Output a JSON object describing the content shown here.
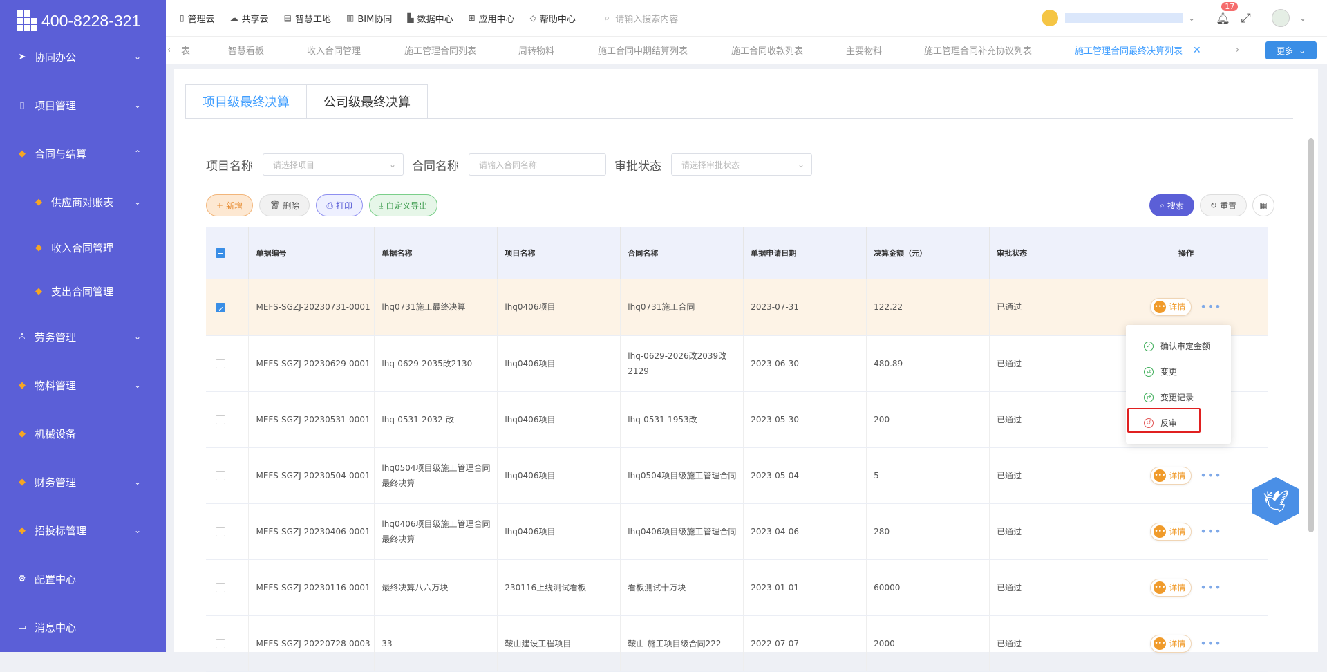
{
  "logo": {
    "phone": "400-8228-321"
  },
  "sidebar": {
    "items": [
      {
        "label": "协同办公",
        "icon": "send-icon"
      },
      {
        "label": "项目管理",
        "icon": "book-icon"
      },
      {
        "label": "合同与结算",
        "icon": "gem-icon"
      },
      {
        "label": "供应商对账表",
        "icon": "gem-icon"
      },
      {
        "label": "收入合同管理",
        "icon": "gem-icon"
      },
      {
        "label": "支出合同管理",
        "icon": "gem-icon"
      },
      {
        "label": "劳务管理",
        "icon": "person-icon"
      },
      {
        "label": "物料管理",
        "icon": "gem-icon"
      },
      {
        "label": "机械设备",
        "icon": "gem-icon"
      },
      {
        "label": "财务管理",
        "icon": "gem-icon"
      },
      {
        "label": "招投标管理",
        "icon": "gem-icon"
      },
      {
        "label": "配置中心",
        "icon": "gear-icon"
      },
      {
        "label": "消息中心",
        "icon": "message-icon"
      }
    ]
  },
  "topnav": {
    "items": [
      "管理云",
      "共享云",
      "智慧工地",
      "BIM协同",
      "数据中心",
      "应用中心",
      "帮助中心"
    ],
    "search_placeholder": "请输入搜索内容",
    "notification_count": "17"
  },
  "tabs": {
    "items": [
      "表",
      "智慧看板",
      "收入合同管理",
      "施工管理合同列表",
      "周转物料",
      "施工合同中期结算列表",
      "施工合同收款列表",
      "主要物料",
      "施工管理合同补充协议列表",
      "施工管理合同最终决算列表"
    ],
    "more_label": "更多"
  },
  "segment": {
    "project": "项目级最终决算",
    "company": "公司级最终决算"
  },
  "filters": {
    "project_label": "项目名称",
    "project_placeholder": "请选择项目",
    "contract_label": "合同名称",
    "contract_placeholder": "请输入合同名称",
    "status_label": "审批状态",
    "status_placeholder": "请选择审批状态"
  },
  "buttons": {
    "new": "新增",
    "delete": "删除",
    "print": "打印",
    "export": "自定义导出",
    "search": "搜索",
    "reset": "重置"
  },
  "table": {
    "headers": [
      "单据编号",
      "单据名称",
      "项目名称",
      "合同名称",
      "单据申请日期",
      "决算金额（元）",
      "审批状态",
      "操作"
    ],
    "rows": [
      {
        "code": "MEFS-SGZJ-20230731-0001",
        "name": "lhq0731施工最终决算",
        "project": "lhq0406项目",
        "contract": "lhq0731施工合同",
        "date": "2023-07-31",
        "amount": "122.22",
        "status": "已通过"
      },
      {
        "code": "MEFS-SGZJ-20230629-0001",
        "name": "lhq-0629-2035改2130",
        "project": "lhq0406项目",
        "contract": "lhq-0629-2026改2039改2129",
        "date": "2023-06-30",
        "amount": "480.89",
        "status": "已通过"
      },
      {
        "code": "MEFS-SGZJ-20230531-0001",
        "name": "lhq-0531-2032-改",
        "project": "lhq0406项目",
        "contract": "lhq-0531-1953改",
        "date": "2023-05-30",
        "amount": "200",
        "status": "已通过"
      },
      {
        "code": "MEFS-SGZJ-20230504-0001",
        "name": "lhq0504项目级施工管理合同最终决算",
        "project": "lhq0406项目",
        "contract": "lhq0504项目级施工管理合同",
        "date": "2023-05-04",
        "amount": "5",
        "status": "已通过"
      },
      {
        "code": "MEFS-SGZJ-20230406-0001",
        "name": "lhq0406项目级施工管理合同最终决算",
        "project": "lhq0406项目",
        "contract": "lhq0406项目级施工管理合同",
        "date": "2023-04-06",
        "amount": "280",
        "status": "已通过"
      },
      {
        "code": "MEFS-SGZJ-20230116-0001",
        "name": "最终决算八六万块",
        "project": "230116上线测试看板",
        "contract": "看板测试十万块",
        "date": "2023-01-01",
        "amount": "60000",
        "status": "已通过"
      },
      {
        "code": "MEFS-SGZJ-20220728-0003",
        "name": "33",
        "project": "鞍山建设工程项目",
        "contract": "鞍山-施工项目级合同222",
        "date": "2022-07-07",
        "amount": "2000",
        "status": "已通过"
      }
    ],
    "detail_label": "详情"
  },
  "dropdown": {
    "items": [
      "确认审定金额",
      "变更",
      "变更记录",
      "反审"
    ]
  }
}
